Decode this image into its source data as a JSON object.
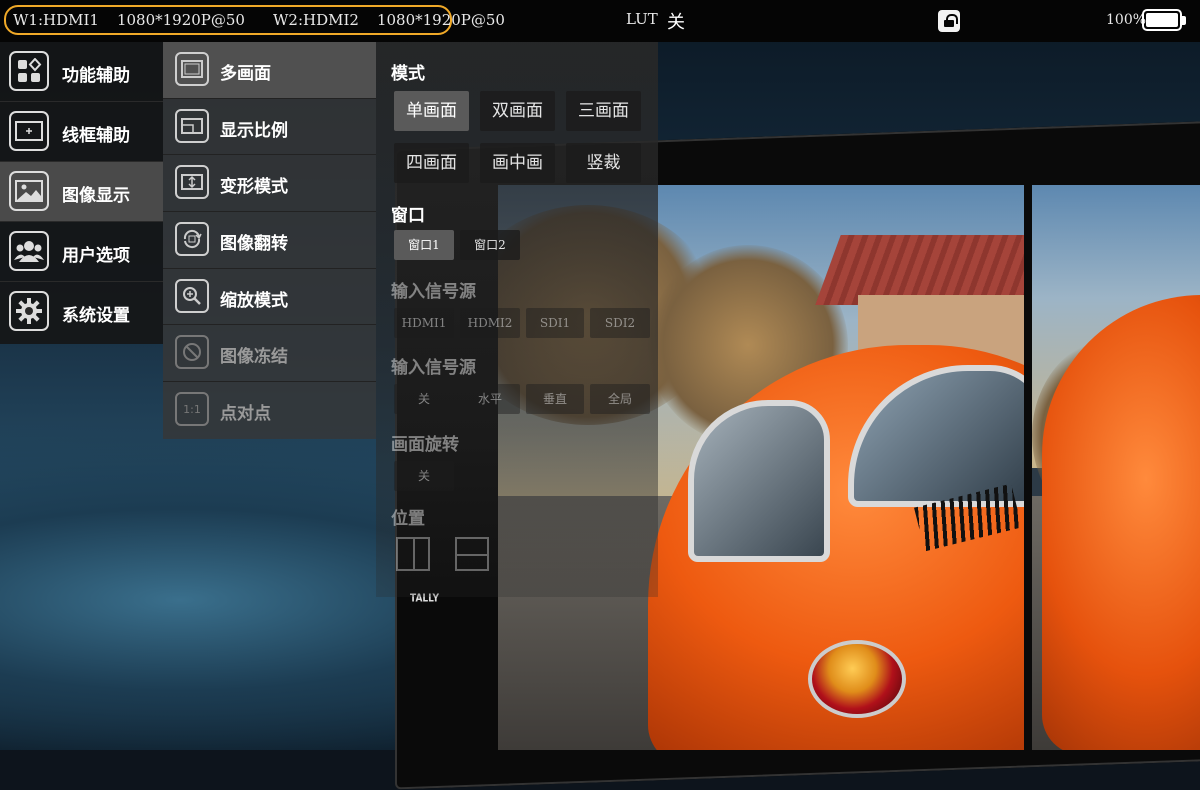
{
  "status_bar": {
    "signals": [
      "W1:HDMI1",
      "1080*1920P@50",
      "W2:HDMI2",
      "1080*1920P@50"
    ],
    "lut_label": "LUT",
    "lut_value": "关",
    "battery_percent": "100%",
    "battery_level": 1.0,
    "highlight_color": "#f0a928"
  },
  "main_menu": {
    "items": [
      {
        "label": "功能辅助",
        "icon": "function-assist-icon"
      },
      {
        "label": "线框辅助",
        "icon": "frame-line-icon"
      },
      {
        "label": "图像显示",
        "icon": "image-display-icon",
        "active": true
      },
      {
        "label": "用户选项",
        "icon": "users-icon"
      },
      {
        "label": "系统设置",
        "icon": "gear-icon"
      }
    ]
  },
  "sub_menu": {
    "items": [
      {
        "label": "多画面",
        "icon": "multi-screen-icon",
        "active": true
      },
      {
        "label": "显示比例",
        "icon": "aspect-ratio-icon"
      },
      {
        "label": "变形模式",
        "icon": "anamorphic-icon"
      },
      {
        "label": "图像翻转",
        "icon": "rotate-icon"
      },
      {
        "label": "缩放模式",
        "icon": "zoom-icon"
      },
      {
        "label": "图像冻结",
        "icon": "freeze-icon",
        "dim": true
      },
      {
        "label": "点对点",
        "icon": "pixel-to-pixel-icon",
        "icon_text": "1:1",
        "dim": true
      }
    ]
  },
  "options": {
    "mode": {
      "title": "模式",
      "buttons": [
        "单画面",
        "双画面",
        "三画面",
        "四画面",
        "画中画",
        "竖裁"
      ],
      "selected": "单画面"
    },
    "window": {
      "title": "窗口",
      "buttons": [
        "窗口1",
        "窗口2"
      ],
      "selected": "窗口1"
    },
    "input_source": {
      "title": "输入信号源",
      "buttons": [
        "HDMI1",
        "HDMI2",
        "SDI1",
        "SDI2"
      ]
    },
    "input_source_2": {
      "title": "输入信号源",
      "buttons": [
        "关",
        "水平",
        "垂直",
        "全局"
      ]
    },
    "rotation": {
      "title": "画面旋转",
      "buttons": [
        "关"
      ]
    },
    "position": {
      "title": "位置"
    }
  },
  "device": {
    "tally_label": "TALLY"
  }
}
